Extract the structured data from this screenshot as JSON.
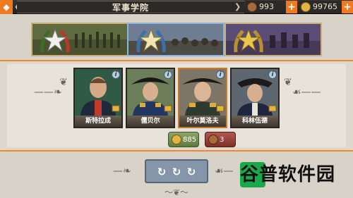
{
  "header": {
    "title": "军事学院",
    "back_icon": "diamond-back-icon",
    "resources": [
      {
        "name": "medals",
        "icon": "medal-icon",
        "value": "993",
        "color": "#a86a3a"
      },
      {
        "name": "gold",
        "icon": "gold-coin-icon",
        "value": "99765",
        "color": "#e2b445"
      }
    ]
  },
  "tabs": [
    {
      "emblem": "rank-star-laurel-green-icon",
      "scene": "army-march-scene"
    },
    {
      "emblem": "rank-star-laurel-blue-icon",
      "scene": "battle-scene",
      "selected": true
    },
    {
      "emblem": "rank-star-laurel-gold-icon",
      "scene": "cavalry-scene"
    }
  ],
  "generals": [
    {
      "name": "斯特拉成",
      "portrait": "portrait-green-coat",
      "rank_icon": "gold-rank-icon"
    },
    {
      "name": "儒贝尔",
      "portrait": "portrait-bicorne-blue",
      "rank_icon": "gold-rank-icon"
    },
    {
      "name": "叶尔莫洛夫",
      "portrait": "portrait-bicorne-white",
      "rank_icon": "gold-rank-icon",
      "highlighted": true
    },
    {
      "name": "科林伍德",
      "portrait": "portrait-tricorne-navy",
      "rank_icon": "gold-rank-icon"
    }
  ],
  "costs": [
    {
      "icon": "gold-coin-icon",
      "value": "885",
      "color": "#6c8a48"
    },
    {
      "icon": "medal-icon",
      "value": "3",
      "color": "#96433a"
    }
  ],
  "refresh": {
    "icons": [
      "refresh-icon",
      "refresh-icon",
      "refresh-icon"
    ]
  },
  "watermark": {
    "text": "谷普软件园",
    "color": "#1aa84a"
  }
}
